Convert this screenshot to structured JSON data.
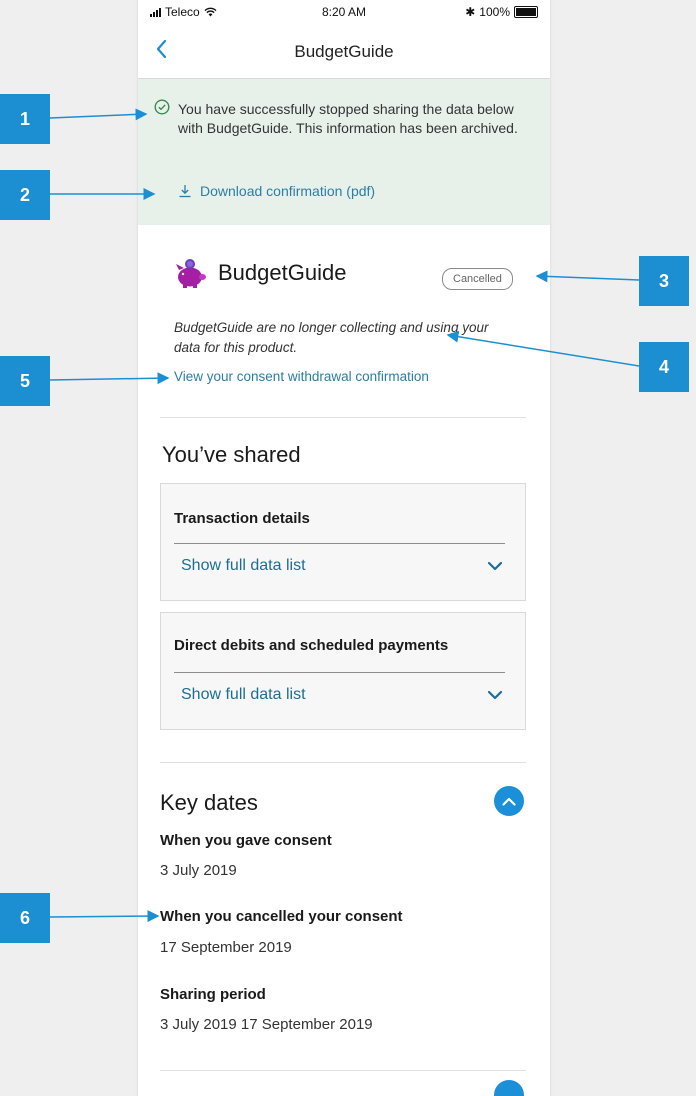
{
  "status_bar": {
    "carrier": "Teleco",
    "time": "8:20 AM",
    "battery": "100%"
  },
  "navbar": {
    "title": "BudgetGuide",
    "back_icon": "chevron-left-icon"
  },
  "banner": {
    "message": "You have successfully stopped sharing the data below with BudgetGuide. This information has been archived.",
    "download_label": "Download confirmation (pdf)"
  },
  "product": {
    "name": "BudgetGuide",
    "status": "Cancelled",
    "description": "BudgetGuide are no longer collecting and using your data for this product.",
    "link": "View your consent withdrawal confirmation"
  },
  "shared": {
    "title": "You’ve shared",
    "items": [
      {
        "title": "Transaction details",
        "link": "Show full data list"
      },
      {
        "title": "Direct debits and scheduled payments",
        "link": "Show full data list"
      }
    ]
  },
  "key_dates": {
    "title": "Key dates",
    "gave_label": "When you gave consent",
    "gave_value": "3 July 2019",
    "cancelled_label": "When you cancelled your consent",
    "cancelled_value": "17 September 2019",
    "period_label": "Sharing period",
    "period_value": "3 July 2019  17 September 2019"
  },
  "annotations": [
    "1",
    "2",
    "3",
    "4",
    "5",
    "6"
  ],
  "colors": {
    "accent": "#1b8fd1",
    "link": "#2a7ea5",
    "banner": "#e7f1ea"
  }
}
